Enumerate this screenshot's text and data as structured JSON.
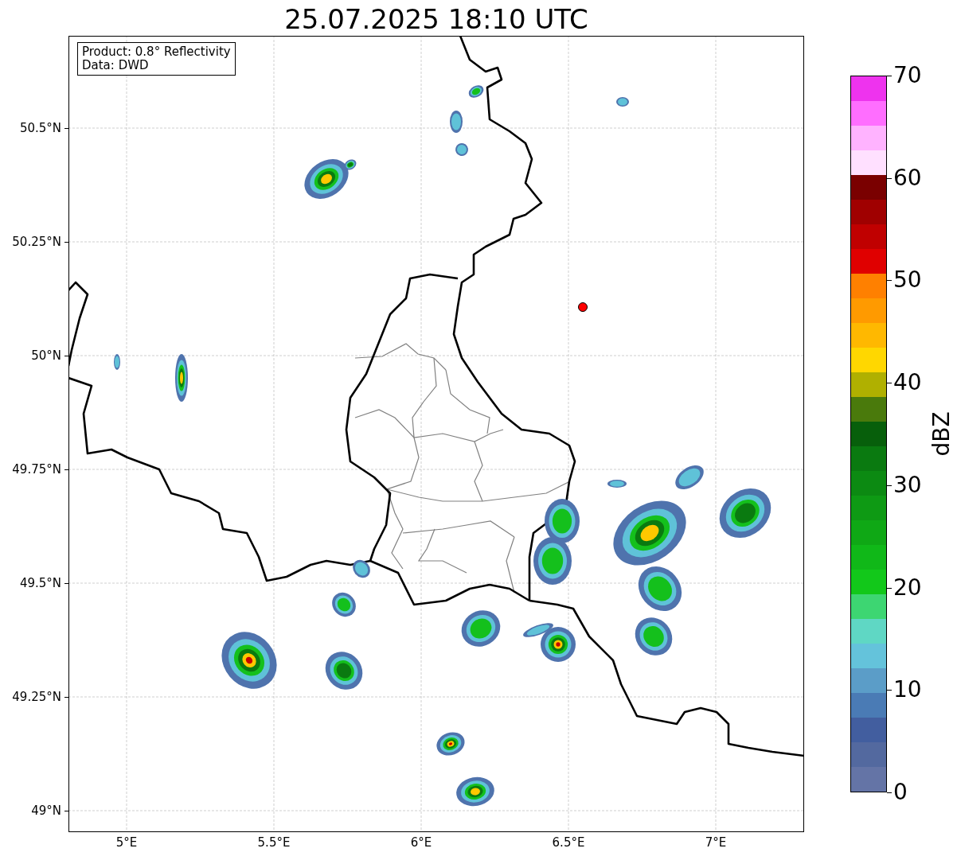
{
  "title": "25.07.2025 18:10 UTC",
  "info_box": [
    "Product: 0.8° Reflectivity",
    "Data: DWD"
  ],
  "lat_ticks": [
    "50.5°N",
    "50.25°N",
    "50°N",
    "49.75°N",
    "49.5°N",
    "49.25°N",
    "49°N"
  ],
  "lon_ticks": [
    "5°E",
    "5.5°E",
    "6°E",
    "6.5°E",
    "7°E"
  ],
  "colorbar": {
    "label": "dBZ",
    "ticks": [
      "70",
      "60",
      "50",
      "40",
      "30",
      "20",
      "10",
      "0"
    ],
    "segments": [
      {
        "color": "#ee33ee"
      },
      {
        "color": "#ff6eff"
      },
      {
        "color": "#ffb3ff"
      },
      {
        "color": "#ffe0ff"
      },
      {
        "color": "#7a0000"
      },
      {
        "color": "#a00000"
      },
      {
        "color": "#c00000"
      },
      {
        "color": "#e00000"
      },
      {
        "color": "#ff8000"
      },
      {
        "color": "#ff9a00"
      },
      {
        "color": "#ffb800"
      },
      {
        "color": "#ffd700"
      },
      {
        "color": "#b0b000"
      },
      {
        "color": "#4a7a0c"
      },
      {
        "color": "#075f0b"
      },
      {
        "color": "#0a7a10"
      },
      {
        "color": "#0c8a12"
      },
      {
        "color": "#0e9a14"
      },
      {
        "color": "#0fa815"
      },
      {
        "color": "#10b818"
      },
      {
        "color": "#12c81a"
      },
      {
        "color": "#3dd672"
      },
      {
        "color": "#5fd7c4"
      },
      {
        "color": "#64c3db"
      },
      {
        "color": "#5b9dc8"
      },
      {
        "color": "#4a7bb5"
      },
      {
        "color": "#425e9f"
      },
      {
        "color": "#53699f"
      },
      {
        "color": "#6474a6"
      }
    ]
  }
}
